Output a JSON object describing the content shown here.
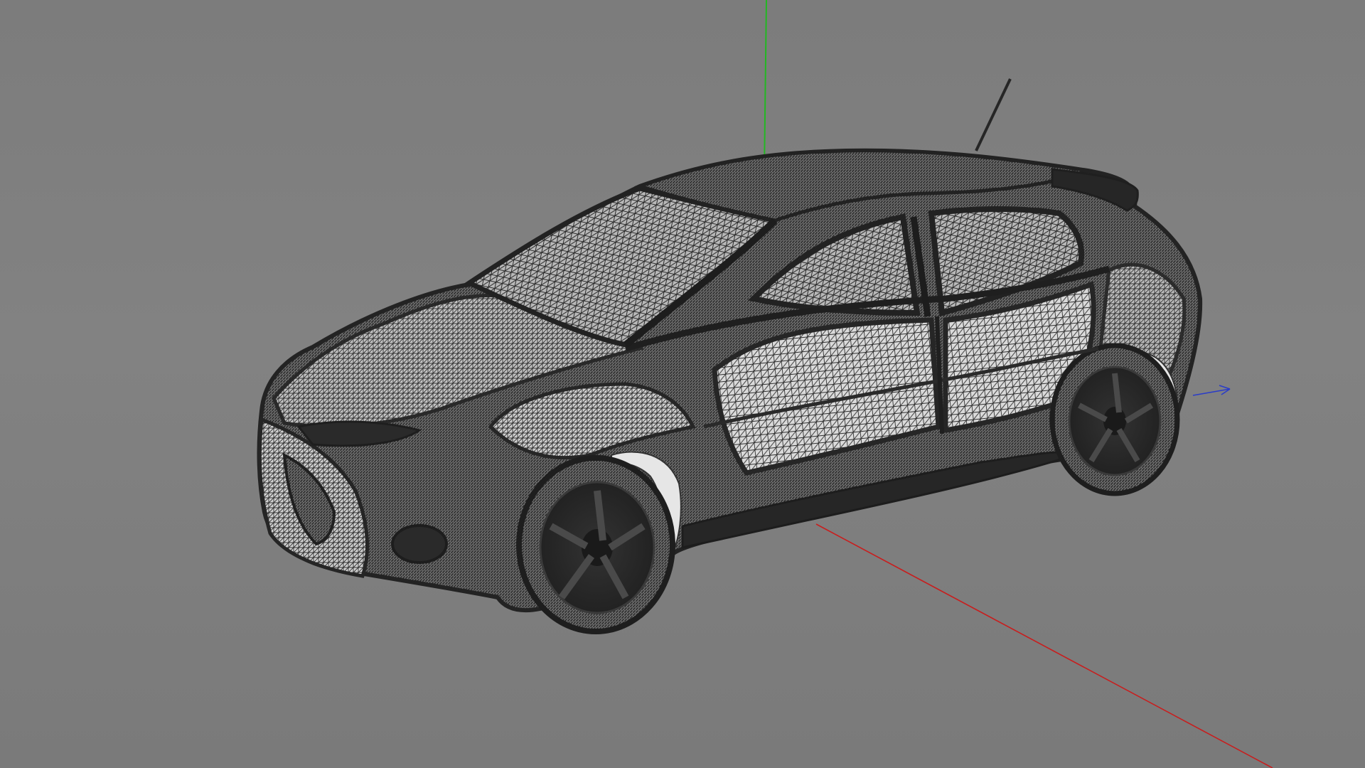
{
  "viewport": {
    "background_top": "#7c7c7c",
    "background_bottom": "#7a7a7a",
    "render_mode": "wireframe"
  },
  "model": {
    "kind": "hatchback-car-mesh",
    "wire_color": "#2b2b2b",
    "mesh_highlight": "#d9d9d9"
  },
  "axes": {
    "x_color": "#c81e1e",
    "y_color": "#22b822",
    "z_color": "#2a3cc8"
  }
}
